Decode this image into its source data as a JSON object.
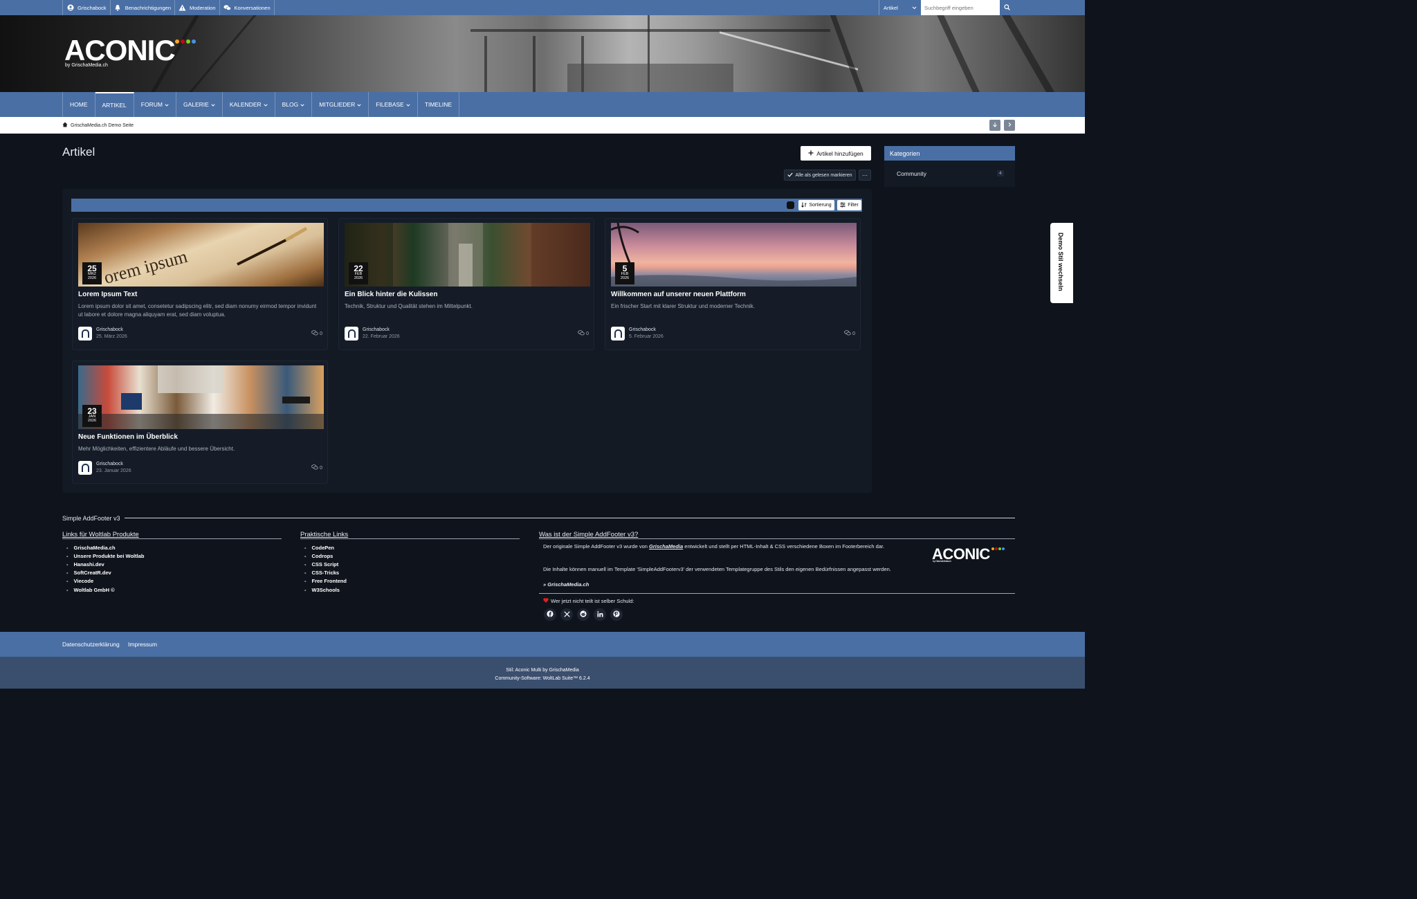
{
  "topbar": {
    "user": "Grischabock",
    "notifications": "Benachrichtigungen",
    "moderation": "Moderation",
    "conversations": "Konversationen",
    "search_scope": "Artikel",
    "search_placeholder": "Suchbegriff eingeben"
  },
  "header": {
    "logo_text": "ACONIC",
    "logo_byline": "by GrischaMedia.ch",
    "logo_dot_colors": [
      "#f5a623",
      "#d0021b",
      "#7ed321",
      "#4a90e2"
    ]
  },
  "nav": {
    "items": [
      {
        "label": "HOME",
        "has_dropdown": false,
        "active": false
      },
      {
        "label": "ARTIKEL",
        "has_dropdown": false,
        "active": true
      },
      {
        "label": "FORUM",
        "has_dropdown": true,
        "active": false
      },
      {
        "label": "GALERIE",
        "has_dropdown": true,
        "active": false
      },
      {
        "label": "KALENDER",
        "has_dropdown": true,
        "active": false
      },
      {
        "label": "BLOG",
        "has_dropdown": true,
        "active": false
      },
      {
        "label": "MITGLIEDER",
        "has_dropdown": true,
        "active": false
      },
      {
        "label": "FILEBASE",
        "has_dropdown": true,
        "active": false
      },
      {
        "label": "TIMELINE",
        "has_dropdown": false,
        "active": false
      }
    ]
  },
  "breadcrumb": {
    "label": "GrischaMedia.ch Demo Seite"
  },
  "page": {
    "title": "Artikel",
    "add_button": "Artikel hinzufügen",
    "mark_read": "Alle als gelesen markieren",
    "more": "···",
    "sort": "Sortierung",
    "filter": "Filter"
  },
  "articles": [
    {
      "day": "25",
      "month": "MRZ",
      "year": "2026",
      "title": "Lorem Ipsum Text",
      "desc": "Lorem ipsum dolor sit amet, consetetur sadipscing elitr, sed diam nonumy eirmod tempor invidunt ut labore et dolore magna aliquyam erat, sed diam voluptua.",
      "author": "Grischabock",
      "date": "25. März 2026",
      "comments": "0"
    },
    {
      "day": "22",
      "month": "FEB",
      "year": "2026",
      "title": "Ein Blick hinter die Kulissen",
      "desc": "Technik, Struktur und Qualität stehen im Mittelpunkt.",
      "author": "Grischabock",
      "date": "22. Februar 2026",
      "comments": "0"
    },
    {
      "day": "5",
      "month": "FEB",
      "year": "2026",
      "title": "Willkommen auf unserer neuen Plattform",
      "desc": "Ein frischer Start mit klarer Struktur und moderner Technik.",
      "author": "Grischabock",
      "date": "5. Februar 2026",
      "comments": "0"
    },
    {
      "day": "23",
      "month": "JAN",
      "year": "2026",
      "title": "Neue Funktionen im Überblick",
      "desc": "Mehr Möglichkeiten, effizientere Abläufe und bessere Übersicht.",
      "author": "Grischabock",
      "date": "23. Januar 2026",
      "comments": "0"
    }
  ],
  "sidebar": {
    "title": "Kategorien",
    "categories": [
      {
        "label": "Community",
        "count": "4"
      }
    ]
  },
  "demo_tab": "Demo Stil wechseln",
  "footer": {
    "title": "Simple AddFooter v3",
    "col1_title": "Links für Woltlab Produkte",
    "col1_links": [
      "GrischaMedia.ch",
      "Unsere Produkte bei Woltlab",
      "Hanashi.dev",
      "SoftCreatR.dev",
      "Viecode",
      "Woltlab GmbH ©"
    ],
    "col2_title": "Praktische Links",
    "col2_links": [
      "CodePen",
      "Codrops",
      "CSS Script",
      "CSS-Tricks",
      "Free Frontend",
      "W3Schools"
    ],
    "col3_title": "Was ist der Simple AddFooter v3?",
    "col3_text1_a": "Der originale Simple AddFooter v3 wurde von ",
    "col3_text1_b": "GrischaMedia",
    "col3_text1_c": " entwickelt und stellt per HTML-Inhalt & CSS verschiedene Boxen im Footerbereich dar.",
    "col3_text2": "Die Inhalte können manuell im Template 'SimpleAddFooterv3' der verwendeten Templategruppe des Stils den eigenen Bedürfnissen angepasst werden.",
    "col3_link": "» GrischaMedia.ch",
    "share_text": "Wer jetzt nicht teilt ist selber Schuld:",
    "logo_text": "ACONIC",
    "logo_byline": "by GrischaMedia.ch"
  },
  "bottom": {
    "privacy": "Datenschutzerklärung",
    "imprint": "Impressum",
    "style": "Stil: Aconic Multi by GrischaMedia",
    "software": "Community-Software: WoltLab Suite™ 6.2.4"
  }
}
